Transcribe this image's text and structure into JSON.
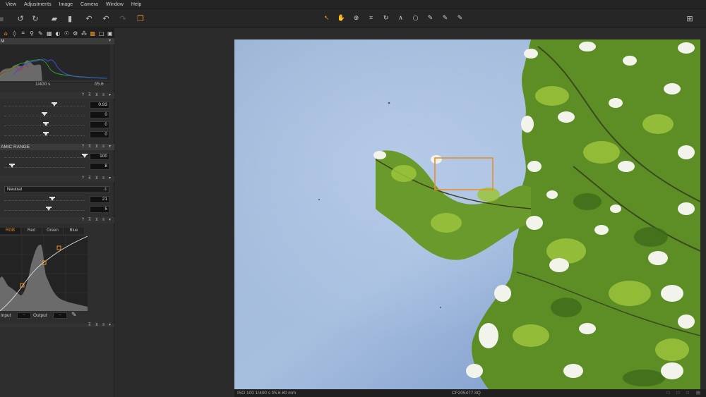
{
  "menu": [
    "View",
    "Adjustments",
    "Image",
    "Camera",
    "Window",
    "Help"
  ],
  "toolbar": {
    "left_icons": [
      "rotate-left-icon",
      "rotate-right-icon",
      "folder-move-icon",
      "trash-icon",
      "undo-icon",
      "undo-step-icon",
      "redo-icon",
      "stack-icon"
    ],
    "cursor_tools": [
      {
        "name": "select-cursor-icon",
        "glyph": "↖"
      },
      {
        "name": "pan-hand-icon",
        "glyph": "✋"
      },
      {
        "name": "zoom-icon",
        "glyph": "⊕"
      },
      {
        "name": "crop-icon",
        "glyph": "⌗"
      },
      {
        "name": "rotate-tool-icon",
        "glyph": "↻"
      },
      {
        "name": "keystone-icon",
        "glyph": "∧"
      },
      {
        "name": "spot-removal-icon",
        "glyph": "○"
      },
      {
        "name": "color-picker-icon",
        "glyph": "✎"
      },
      {
        "name": "wb-picker-icon",
        "glyph": "✎"
      },
      {
        "name": "annotate-icon",
        "glyph": "✎"
      }
    ],
    "right_icon": "viewer-layout-icon",
    "accent": "#e8902a"
  },
  "tool_tabs": [
    {
      "name": "tab-library-icon",
      "glyph": "⌂",
      "active": true
    },
    {
      "name": "tab-capture-icon",
      "glyph": "◊"
    },
    {
      "name": "tab-crop-icon",
      "glyph": "⌗"
    },
    {
      "name": "tab-focus-icon",
      "glyph": "⚲"
    },
    {
      "name": "tab-color-icon",
      "glyph": "✎"
    },
    {
      "name": "tab-exposure-icon",
      "glyph": "▦"
    },
    {
      "name": "tab-details-icon",
      "glyph": "◐"
    },
    {
      "name": "tab-local-icon",
      "glyph": "☉"
    },
    {
      "name": "tab-adjust-icon",
      "glyph": "⚙"
    },
    {
      "name": "tab-metadata-icon",
      "glyph": "⁂"
    },
    {
      "name": "tab-batch-icon",
      "glyph": "▩",
      "active": true
    },
    {
      "name": "tab-output-icon",
      "glyph": "□"
    },
    {
      "name": "tab-grid-icon",
      "glyph": "▣"
    }
  ],
  "panel": {
    "histogram_header": "M",
    "shutter": "1/400 s",
    "aperture": "f/5.6",
    "exposure": {
      "values": [
        "0.93",
        "0",
        "0",
        "0"
      ],
      "levels": [
        0.62,
        0.5,
        0.52,
        0.52
      ]
    },
    "hdr": {
      "header": "AMIC RANGE",
      "values": [
        "100",
        "8"
      ],
      "levels": [
        1.0,
        0.1
      ]
    },
    "clarity": {
      "method": "Neutral",
      "values": [
        "21",
        "5"
      ],
      "levels": [
        0.6,
        0.55
      ]
    },
    "curve": {
      "tabs": [
        "RGB",
        "Red",
        "Green",
        "Blue"
      ],
      "input_label": "Input",
      "output_label": "Output",
      "input_value": "--",
      "output_value": "--"
    }
  },
  "status": {
    "exif": "ISO 100  1/400 s  f/5.6  80 mm",
    "filename": "CF205477.IIQ",
    "icons": "□ □ □ ▤"
  }
}
